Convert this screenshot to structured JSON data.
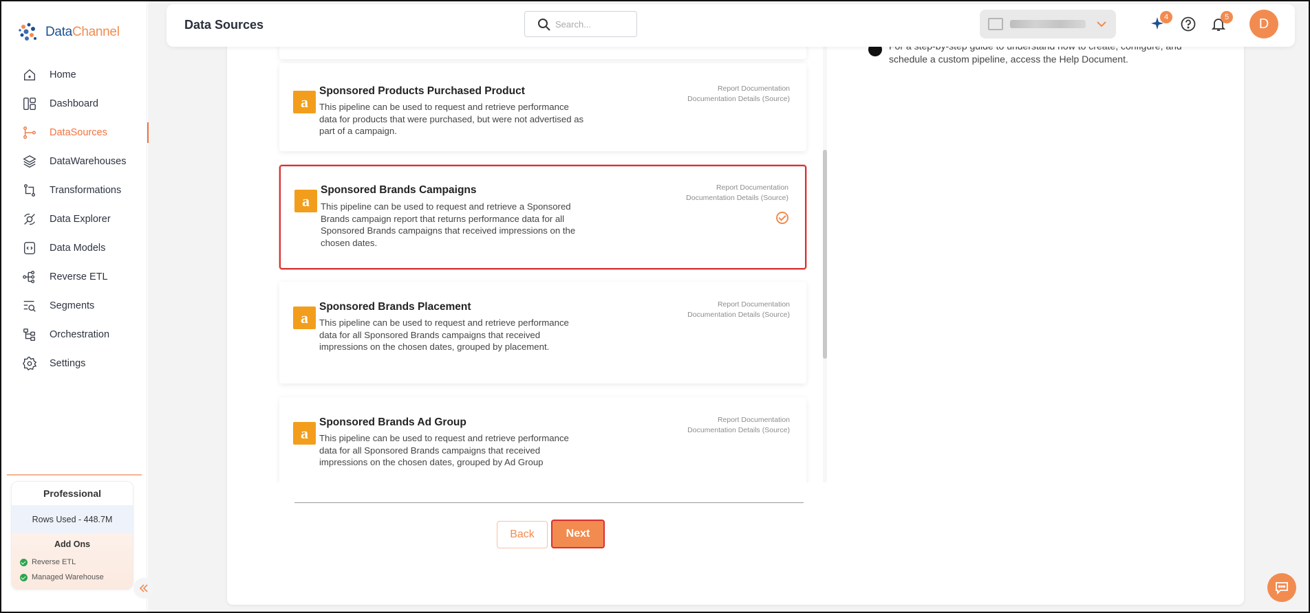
{
  "app": {
    "logo_text_a": "Data",
    "logo_text_b": "Channel",
    "page_title": "Data Sources",
    "brand_color": "#f28b50"
  },
  "search": {
    "placeholder": "Search..."
  },
  "header": {
    "ai_badge": "4",
    "notification_badge": "5",
    "avatar_initial": "D"
  },
  "sidebar": {
    "items": [
      {
        "label": "Home",
        "icon": "home-icon"
      },
      {
        "label": "Dashboard",
        "icon": "dashboard-icon"
      },
      {
        "label": "DataSources",
        "icon": "datasources-icon",
        "active": true
      },
      {
        "label": "DataWarehouses",
        "icon": "layers-icon"
      },
      {
        "label": "Transformations",
        "icon": "transform-icon"
      },
      {
        "label": "Data Explorer",
        "icon": "explorer-icon"
      },
      {
        "label": "Data Models",
        "icon": "models-icon"
      },
      {
        "label": "Reverse ETL",
        "icon": "reverse-etl-icon"
      },
      {
        "label": "Segments",
        "icon": "segments-icon"
      },
      {
        "label": "Orchestration",
        "icon": "orchestration-icon"
      },
      {
        "label": "Settings",
        "icon": "gear-icon"
      }
    ],
    "plan": {
      "name": "Professional",
      "rows_used": "Rows Used - 448.7M",
      "addons_title": "Add Ons",
      "addons": [
        "Reverse ETL",
        "Managed Warehouse"
      ]
    }
  },
  "help": {
    "text": "For a step-by-step guide to understand how to create, configure, and schedule a custom pipeline, access the Help Document."
  },
  "pipelines": [
    {
      "title": "Sponsored Products Purchased Product",
      "description": "This pipeline can be used to request and retrieve performance data for products that were purchased, but were not advertised as part of a campaign.",
      "link1": "Report Documentation",
      "link2": "Documentation Details (Source)",
      "selected": false
    },
    {
      "title": "Sponsored Brands Campaigns",
      "description": "This pipeline can be used to request and retrieve a Sponsored Brands campaign report that returns performance data for all Sponsored Brands campaigns that received impressions on the chosen dates.",
      "link1": "Report Documentation",
      "link2": "Documentation Details (Source)",
      "selected": true
    },
    {
      "title": "Sponsored Brands Placement",
      "description": "This pipeline can be used to request and retrieve performance data for all Sponsored Brands campaigns that received impressions on the chosen dates, grouped by placement.",
      "link1": "Report Documentation",
      "link2": "Documentation Details (Source)",
      "selected": false
    },
    {
      "title": "Sponsored Brands Ad Group",
      "description": "This pipeline can be used to request and retrieve performance data for all Sponsored Brands campaigns that received impressions on the chosen dates, grouped by Ad Group",
      "link1": "Report Documentation",
      "link2": "Documentation Details (Source)",
      "selected": false
    }
  ],
  "buttons": {
    "back": "Back",
    "next": "Next"
  }
}
